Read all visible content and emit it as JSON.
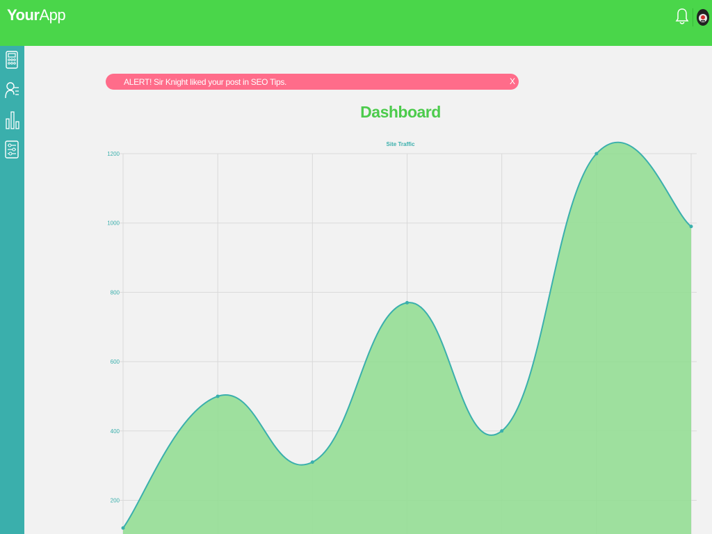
{
  "app": {
    "title_bold": "Your",
    "title_rest": "App"
  },
  "header": {
    "bell_icon": "bell-icon",
    "avatar_icon": "user-avatar"
  },
  "sidebar": {
    "items": [
      {
        "icon": "calculator-icon"
      },
      {
        "icon": "users-list-icon"
      },
      {
        "icon": "bar-chart-icon"
      },
      {
        "icon": "sliders-icon"
      }
    ]
  },
  "alert": {
    "text": "ALERT! Sir Knight liked your post in SEO Tips.",
    "close": "X"
  },
  "page": {
    "title": "Dashboard"
  },
  "colors": {
    "header": "#4ad64a",
    "sidebar": "#3aafac",
    "alert": "#ff6c8a",
    "line": "#3aafac",
    "fill": "#8fdd8f"
  },
  "chart_data": {
    "type": "area",
    "title": "Site Traffic",
    "y_ticks": [
      "1200",
      "1000",
      "800",
      "600",
      "400",
      "200"
    ],
    "ylim": [
      0,
      1200
    ],
    "series": [
      {
        "values": [
          120,
          500,
          310,
          770,
          400,
          1200,
          990
        ]
      }
    ],
    "grid": true
  }
}
